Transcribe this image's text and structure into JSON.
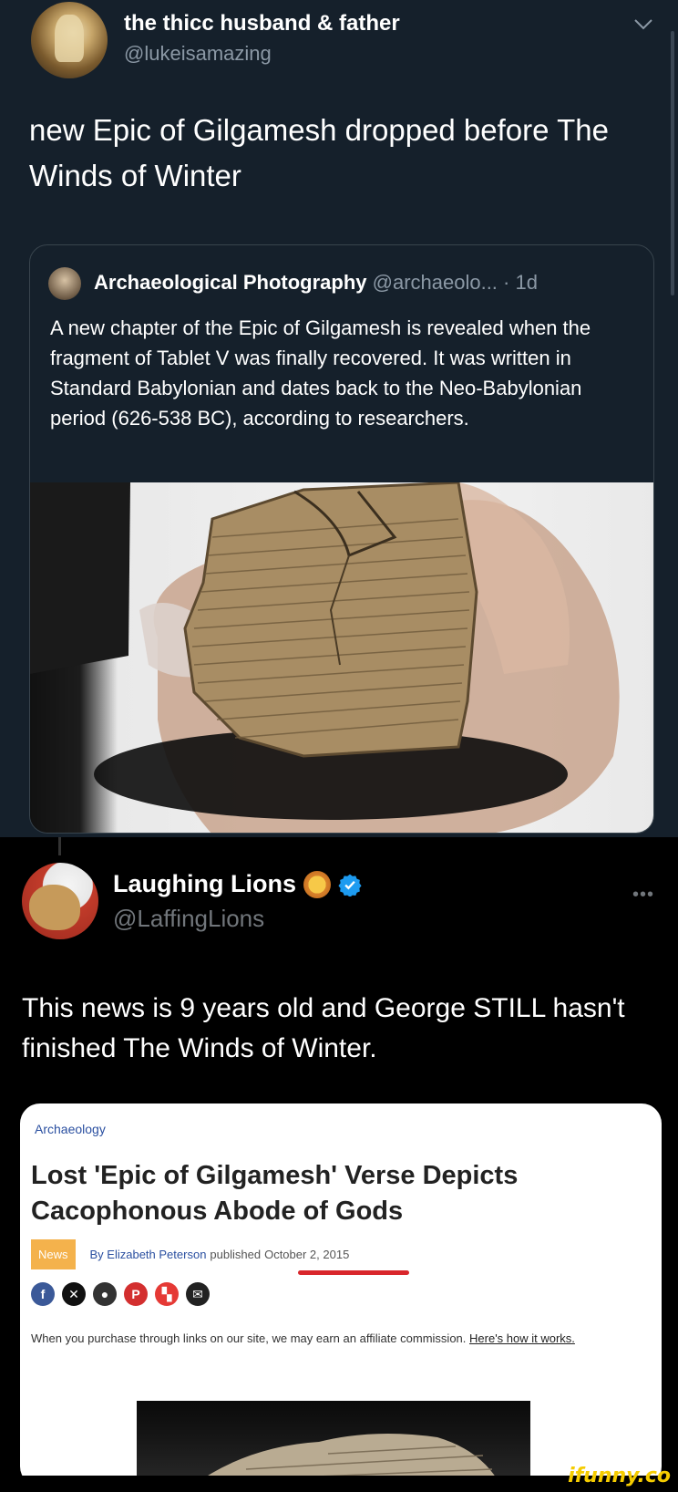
{
  "tweet": {
    "author_name": "the thicc husband & father",
    "author_handle": "@lukeisamazing",
    "text": "new Epic of Gilgamesh dropped before The Winds of Winter",
    "quote": {
      "author_name": "Archaeological Photography",
      "author_handle": "@archaeolo...",
      "time": "· 1d",
      "text": "A new chapter of the Epic of Gilgamesh is revealed when the fragment of Tablet V was finally recovered. It was written in Standard Babylonian and dates back to the Neo-Babylonian period (626-538 BC), according to researchers."
    }
  },
  "reply": {
    "author_name": "Laughing Lions",
    "author_handle": "@LaffingLions",
    "more": "•••",
    "text": "This news is 9 years old and George STILL hasn't finished The Winds of Winter.",
    "article": {
      "category": "Archaeology",
      "title": "Lost 'Epic of Gilgamesh' Verse Depicts Cacophonous Abode of Gods",
      "badge": "News",
      "byline": "By Elizabeth Peterson",
      "published_label": "published",
      "date": "October 2, 2015",
      "disclaimer": "When you purchase through links on our site, we may earn an affiliate commission.",
      "disclaimer_link": "Here's how it works."
    }
  },
  "watermark": "ifunny.co",
  "colors": {
    "dim_bg": "#15202b",
    "black_bg": "#000000",
    "verified_blue": "#1d9bf0",
    "badge_orange": "#f4b24c",
    "underline_red": "#d9262b"
  },
  "icons": [
    "chevron-down-icon",
    "verified-badge-icon",
    "lion-emoji-icon",
    "more-options-icon",
    "facebook-icon",
    "x-icon",
    "reddit-icon",
    "pinterest-icon",
    "flipboard-icon",
    "email-icon"
  ]
}
